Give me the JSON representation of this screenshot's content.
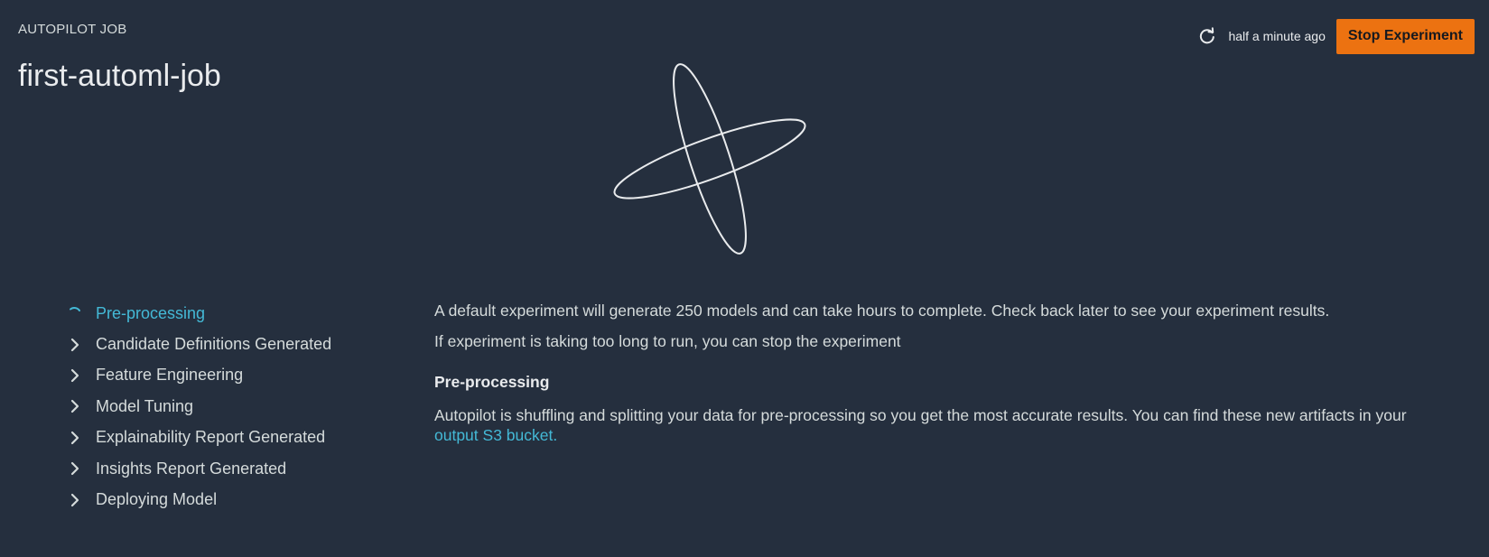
{
  "header": {
    "eyebrow": "AUTOPILOT JOB",
    "title": "first-automl-job",
    "last_updated": "half a minute ago",
    "refresh_icon": "refresh-icon",
    "stop_button_label": "Stop Experiment",
    "stop_button_color": "#ec7211"
  },
  "steps": [
    {
      "label": "Pre-processing",
      "icon": "spinner-icon",
      "state": "in-progress"
    },
    {
      "label": "Candidate Definitions Generated",
      "icon": "chevron-right-icon",
      "state": "pending"
    },
    {
      "label": "Feature Engineering",
      "icon": "chevron-right-icon",
      "state": "pending"
    },
    {
      "label": "Model Tuning",
      "icon": "chevron-right-icon",
      "state": "pending"
    },
    {
      "label": "Explainability Report Generated",
      "icon": "chevron-right-icon",
      "state": "pending"
    },
    {
      "label": "Insights Report Generated",
      "icon": "chevron-right-icon",
      "state": "pending"
    },
    {
      "label": "Deploying Model",
      "icon": "chevron-right-icon",
      "state": "pending"
    }
  ],
  "detail": {
    "intro": "A default experiment will generate 250 models and can take hours to complete. Check back later to see your experiment results.",
    "stop_hint": "If experiment is taking too long to run, you can stop the experiment",
    "section_title": "Pre-processing",
    "section_body": "Autopilot is shuffling and splitting your data for pre-processing so you get the most accurate results. You can find these new artifacts in your ",
    "link_text": "output S3 bucket."
  },
  "colors": {
    "background": "#252f3e",
    "text": "#d5dbdb",
    "accent_link": "#44b9d6"
  }
}
